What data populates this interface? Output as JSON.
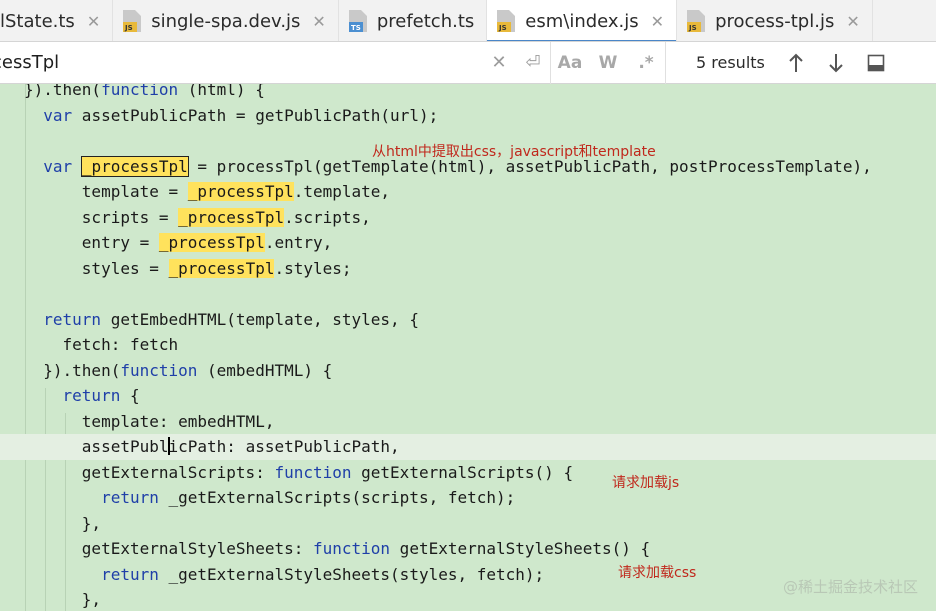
{
  "tabs": [
    {
      "label": "lState.ts",
      "icon": "none",
      "active": false,
      "closable": true
    },
    {
      "label": "single-spa.dev.js",
      "icon": "js-file-icon",
      "active": false,
      "closable": true
    },
    {
      "label": "prefetch.ts",
      "icon": "ts-file-icon",
      "active": false,
      "closable": false
    },
    {
      "label": "esm\\index.js",
      "icon": "js-file-icon",
      "active": true,
      "closable": true
    },
    {
      "label": "process-tpl.js",
      "icon": "js-file-icon",
      "active": false,
      "closable": true
    }
  ],
  "search": {
    "value": "cessTpl",
    "results": "5 results",
    "match_case": "Aa",
    "words": "W",
    "regex": ".*"
  },
  "code_lines": [
    "}).then(function (html) {",
    "  var assetPublicPath = getPublicPath(url);",
    "",
    "  var _processTpl = processTpl(getTemplate(html), assetPublicPath, postProcessTemplate),",
    "      template = _processTpl.template,",
    "      scripts = _processTpl.scripts,",
    "      entry = _processTpl.entry,",
    "      styles = _processTpl.styles;",
    "",
    "  return getEmbedHTML(template, styles, {",
    "    fetch: fetch",
    "  }).then(function (embedHTML) {",
    "    return {",
    "      template: embedHTML,",
    "      assetPublicPath: assetPublicPath,",
    "      getExternalScripts: function getExternalScripts() {",
    "        return _getExternalScripts(scripts, fetch);",
    "      },",
    "      getExternalStyleSheets: function getExternalStyleSheets() {",
    "        return _getExternalStyleSheets(styles, fetch);",
    "      },"
  ],
  "annotations": {
    "extract": "从html中提取出css，javascript和template",
    "load_js": "请求加载js",
    "load_css": "请求加载css"
  },
  "watermark": "@稀土掘金技术社区",
  "colors": {
    "editor_bg": "#cfe8cc",
    "keyword": "#1f3fa8",
    "match_highlight": "#ffe25c",
    "annotation": "#c0281c",
    "active_tab_underline": "#4a86c8"
  }
}
